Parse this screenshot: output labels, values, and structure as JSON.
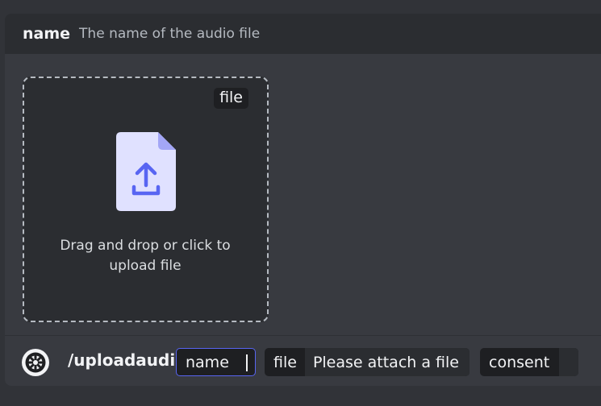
{
  "option": {
    "name": "name",
    "description": "The name of the audio file"
  },
  "upload": {
    "type_tag": "file",
    "icon": "file-upload-icon",
    "text_line1": "Drag and drop or click to",
    "text_line2": "upload file"
  },
  "command": {
    "app_icon": "bot-app-icon",
    "name": "/uploadaudio",
    "params": [
      {
        "label": "name",
        "value": ""
      },
      {
        "label": "file",
        "value": "Please attach a file"
      },
      {
        "label": "consent",
        "value": ""
      }
    ]
  },
  "colors": {
    "accent": "#5865f2",
    "icon_fill": "#e0e1ff",
    "icon_fold": "#a3a6f6",
    "icon_arrow": "#5865f2"
  }
}
